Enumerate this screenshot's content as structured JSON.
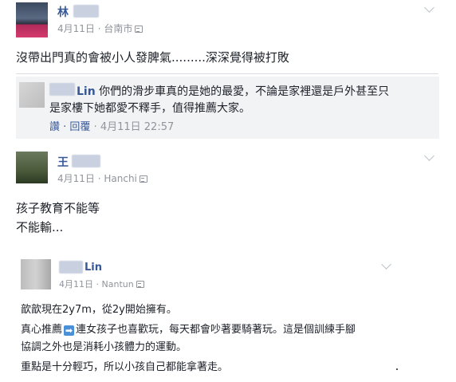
{
  "post1": {
    "author": "林",
    "date": "4月11日",
    "location": "台南市",
    "sep": " · ",
    "text": "沒帶出門真的會被小人發脾氣.........深深覺得被打敗",
    "reply": {
      "author": "Lin",
      "text_line1": "你們的滑步車真的是她的最愛，不論是家裡還是戶外甚至只",
      "text_line2": "是家樓下她都愛不釋手，值得推薦大家。",
      "like_label": "讚",
      "reply_label": "回覆",
      "timestamp": "4月11日 22:57",
      "dot": " · "
    }
  },
  "post2": {
    "author": "王",
    "date": "4月11日",
    "location": "Hanchi",
    "sep": " · ",
    "line1": "孩子教育不能等",
    "line2": "不能輸..."
  },
  "post3": {
    "author": "Lin",
    "date": "4月11日",
    "location": "Nantun",
    "sep": " · ",
    "line1": "歆歆現在2y7m，從2y開始擁有。",
    "line2_pre": "真心推薦",
    "line2_icon": "right-arrow-emoji-icon",
    "line2_post": "連女孩子也喜歡玩，每天都會吵著要騎著玩。這是個訓練手腳",
    "line3": "協調之外也是消耗小孩體力的運動。",
    "line4": "重點是十分輕巧，所以小孩自己都能拿著走。"
  },
  "colors": {
    "link": "#365899",
    "meta": "#90949c",
    "text": "#1d2129",
    "reply_bg": "#f2f3f5",
    "arrow_badge": "#4a90d9"
  }
}
